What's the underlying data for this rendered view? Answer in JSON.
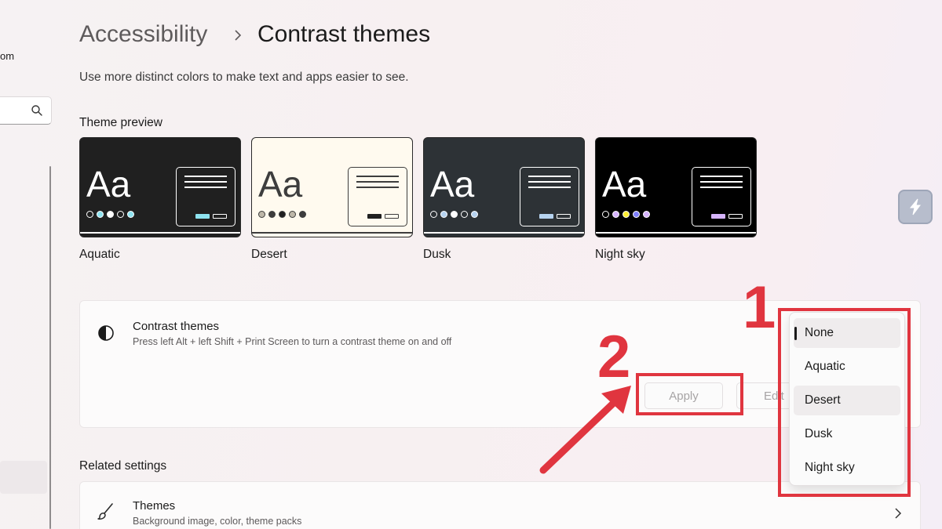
{
  "nav": {
    "account_fragment": "om",
    "search_icon": "search-icon"
  },
  "header": {
    "breadcrumb_parent": "Accessibility",
    "breadcrumb_current": "Contrast themes",
    "subtitle": "Use more distinct colors to make text and apps easier to see."
  },
  "preview": {
    "title": "Theme preview",
    "sample_text": "Aa",
    "themes": [
      {
        "name": "Aquatic",
        "bg": "#202020",
        "fg": "#ffffff",
        "dots": [
          "#202020",
          "#8ee3f0",
          "#ffffff",
          "#202020",
          "#8ee3f0"
        ],
        "b1": "#8ee3f0",
        "accent": "#ffffff"
      },
      {
        "name": "Desert",
        "bg": "#fffaef",
        "fg": "#3d3d3d",
        "dots": [
          "#bdb7a9",
          "#3d3d3d",
          "#202020",
          "#bdb7a9",
          "#3d3d3d"
        ],
        "b1": "#202020",
        "accent": "#3d3d3d"
      },
      {
        "name": "Dusk",
        "bg": "#2d3236",
        "fg": "#ffffff",
        "dots": [
          "#2d3236",
          "#b6d3f0",
          "#ffffff",
          "#2d3236",
          "#b6d3f0"
        ],
        "b1": "#b6d3f0",
        "accent": "#ffffff"
      },
      {
        "name": "Night sky",
        "bg": "#000000",
        "fg": "#ffffff",
        "dots": [
          "#000000",
          "#d6b4fd",
          "#ffee32",
          "#8080ff",
          "#d6b4fd"
        ],
        "b1": "#d6b4fd",
        "accent": "#ffffff"
      }
    ]
  },
  "contrast": {
    "title": "Contrast themes",
    "description": "Press left Alt + left Shift + Print Screen to turn a contrast theme on and off",
    "icon": "contrast-icon",
    "apply_label": "Apply",
    "edit_label": "Edit",
    "options": [
      "None",
      "Aquatic",
      "Desert",
      "Dusk",
      "Night sky"
    ],
    "selected": "None"
  },
  "related": {
    "title": "Related settings",
    "themes_title": "Themes",
    "themes_desc": "Background image, color, theme packs",
    "icon": "brush-icon"
  },
  "annotations": {
    "step1": "1",
    "step2": "2",
    "color": "#e0353f"
  }
}
